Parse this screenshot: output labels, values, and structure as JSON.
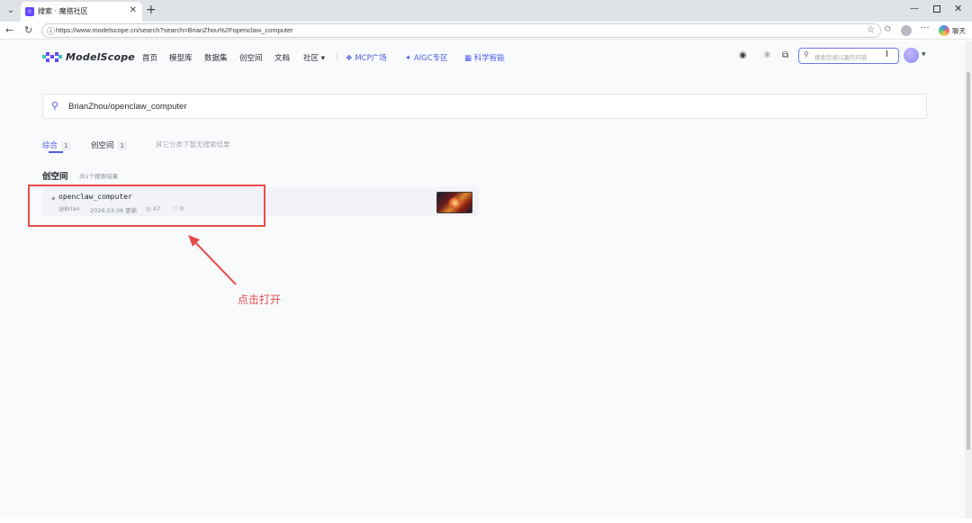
{
  "browser": {
    "tab_title": "搜索 · 魔搭社区",
    "new_tab": "+",
    "tab_close": "✕",
    "url": "https://www.modelscope.cn/search?search=BrianZhou%2Fopenclaw_computer",
    "copilot_label": "聊天"
  },
  "header": {
    "logo_text": "ModelScope",
    "nav": [
      "首页",
      "模型库",
      "数据集",
      "创空间",
      "文档"
    ],
    "community": "社区 ▾",
    "mcp": "MCP广场",
    "aigc": "AIGC专区",
    "science": "科学智能",
    "search_placeholder": "搜索您感兴趣的内容"
  },
  "search": {
    "query": "BrianZhou/openclaw_computer"
  },
  "tabs": [
    {
      "label": "综合",
      "count": "1"
    },
    {
      "label": "创空间",
      "count": "1"
    }
  ],
  "tab_note": "其它分类下暂无搜索结果",
  "section": {
    "title": "创空间",
    "count": "共1个搜索结果"
  },
  "result": {
    "title": "openclaw_computer",
    "author": "@Brian",
    "date": "2026.03.06 更新",
    "views": "47",
    "likes": "0"
  },
  "annotation": "点击打开"
}
